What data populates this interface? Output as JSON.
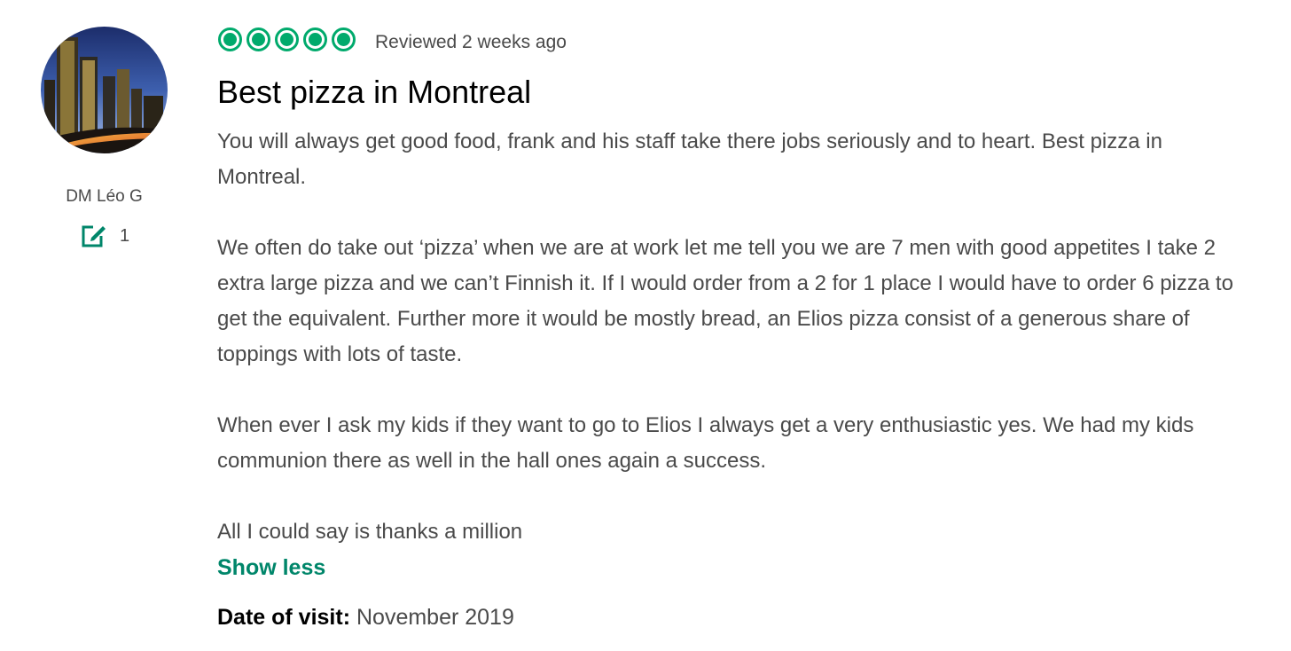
{
  "reviewer": {
    "name": "DM Léo G",
    "contributions": "1",
    "avatar_icon": "city-skyline-avatar",
    "contribution_icon": "edit-review-icon"
  },
  "review": {
    "rating": 5,
    "rating_max": 5,
    "rating_color": "#00aa6c",
    "reviewed": "Reviewed 2 weeks ago",
    "title": "Best pizza in Montreal",
    "paragraphs": [
      "You will always get good food, frank and his staff take there jobs seriously and to heart. Best pizza in Montreal.",
      "We often do take out ‘pizza’ when we are at work let me tell you we are 7 men with good appetites I take 2 extra large pizza and we can’t Finnish it. If I would order from a 2 for 1 place I would have to order 6 pizza to get the equivalent. Further more it would be mostly bread, an Elios pizza consist of a generous share of toppings with lots of taste.",
      "When ever I ask my kids if they want to go to Elios I always get a very enthusiastic yes. We had my kids communion there as well in the hall ones again a success.",
      "All I could say is thanks a million"
    ],
    "show_less_label": "Show less",
    "link_color": "#00866a",
    "visit_label": "Date of visit:",
    "visit_date": "November 2019"
  }
}
